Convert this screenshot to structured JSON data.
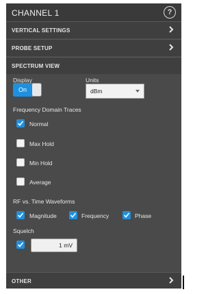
{
  "header": {
    "title": "CHANNEL 1",
    "help_icon": "help-icon",
    "help_glyph": "?"
  },
  "sections": {
    "vertical": {
      "label": "VERTICAL SETTINGS"
    },
    "probe": {
      "label": "PROBE SETUP"
    },
    "spectrum": {
      "label": "SPECTRUM VIEW"
    },
    "other": {
      "label": "OTHER"
    }
  },
  "display": {
    "label": "Display",
    "state": "On"
  },
  "units": {
    "label": "Units",
    "value": "dBm"
  },
  "frequency_domain": {
    "heading": "Frequency Domain Traces",
    "items": [
      {
        "label": "Normal",
        "checked": true
      },
      {
        "label": "Max Hold",
        "checked": false
      },
      {
        "label": "Min Hold",
        "checked": false
      },
      {
        "label": "Average",
        "checked": false
      }
    ]
  },
  "rf_time": {
    "heading": "RF vs. Time Waveforms",
    "items": [
      {
        "label": "Magnitude",
        "checked": true
      },
      {
        "label": "Frequency",
        "checked": true
      },
      {
        "label": "Phase",
        "checked": true
      }
    ]
  },
  "squelch": {
    "label": "Squelch",
    "checked": true,
    "value": "1 mV"
  },
  "colors": {
    "accent": "#1e90e0",
    "panel": "#4a4a4a",
    "header": "#3a3a3a"
  }
}
